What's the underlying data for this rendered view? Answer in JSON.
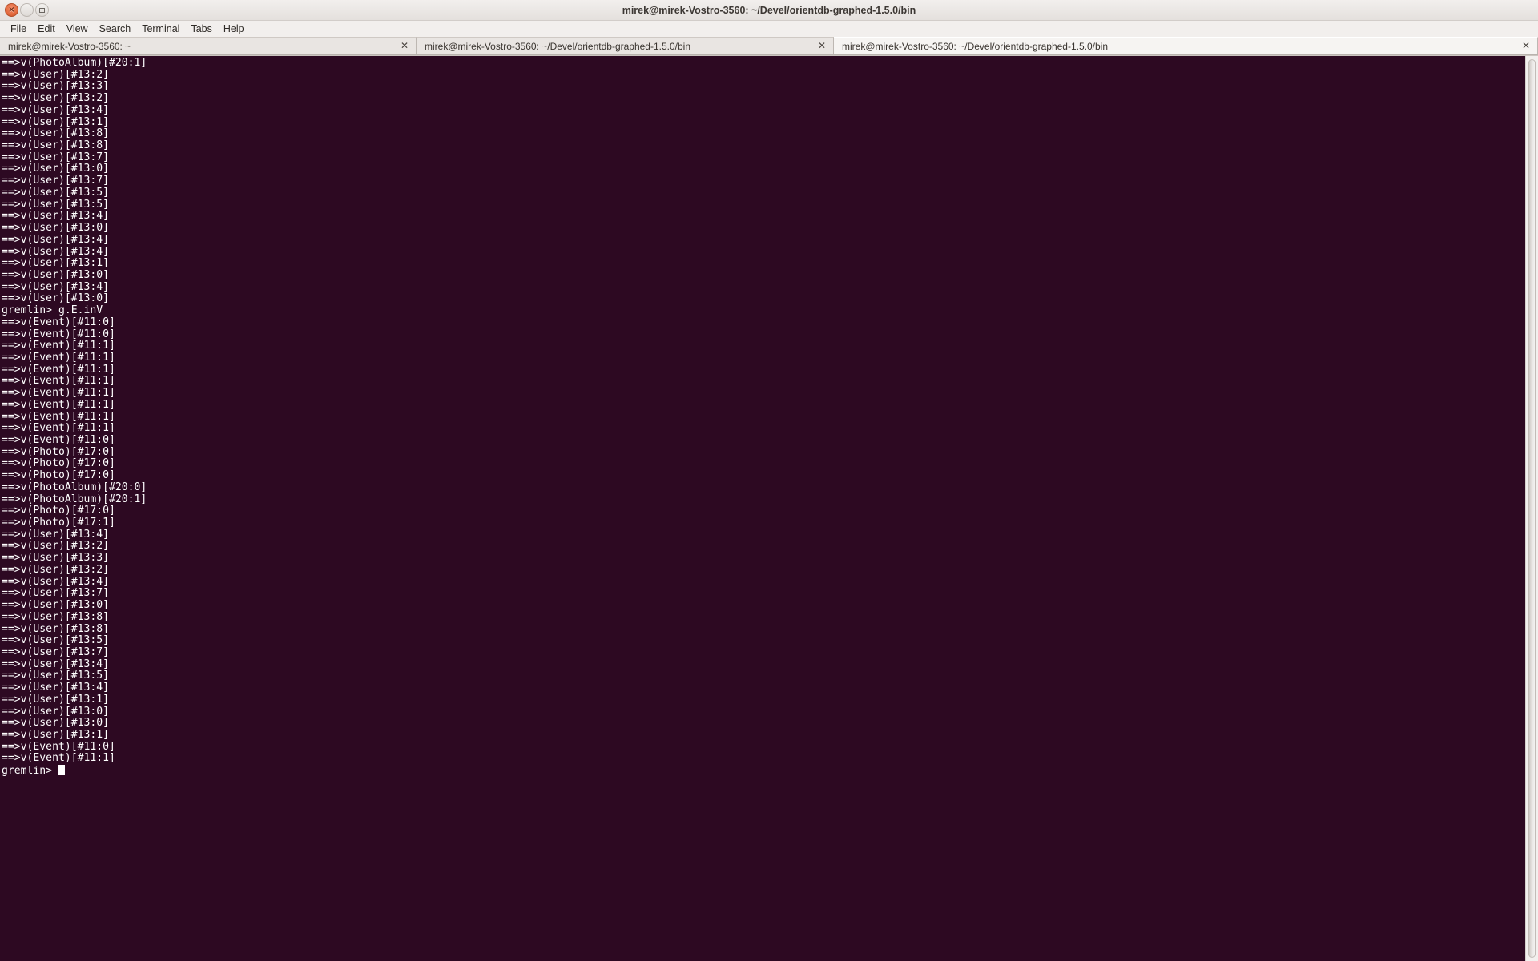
{
  "window": {
    "title": "mirek@mirek-Vostro-3560: ~/Devel/orientdb-graphed-1.5.0/bin",
    "close_label": "×",
    "minimize_label": "",
    "maximize_label": ""
  },
  "menubar": {
    "items": [
      {
        "label": "File"
      },
      {
        "label": "Edit"
      },
      {
        "label": "View"
      },
      {
        "label": "Search"
      },
      {
        "label": "Terminal"
      },
      {
        "label": "Tabs"
      },
      {
        "label": "Help"
      }
    ]
  },
  "tabs": {
    "close_label": "✕",
    "items": [
      {
        "label": "mirek@mirek-Vostro-3560: ~",
        "active": false
      },
      {
        "label": "mirek@mirek-Vostro-3560: ~/Devel/orientdb-graphed-1.5.0/bin",
        "active": false
      },
      {
        "label": "mirek@mirek-Vostro-3560: ~/Devel/orientdb-graphed-1.5.0/bin",
        "active": true
      }
    ]
  },
  "terminal": {
    "background_color": "#2d0922",
    "foreground_color": "#ffffff",
    "prompt": "gremlin>",
    "command": "g.E.inV",
    "cursor_visible": true,
    "lines": [
      "==>v(PhotoAlbum)[#20:1]",
      "==>v(User)[#13:2]",
      "==>v(User)[#13:3]",
      "==>v(User)[#13:2]",
      "==>v(User)[#13:4]",
      "==>v(User)[#13:1]",
      "==>v(User)[#13:8]",
      "==>v(User)[#13:8]",
      "==>v(User)[#13:7]",
      "==>v(User)[#13:0]",
      "==>v(User)[#13:7]",
      "==>v(User)[#13:5]",
      "==>v(User)[#13:5]",
      "==>v(User)[#13:4]",
      "==>v(User)[#13:0]",
      "==>v(User)[#13:4]",
      "==>v(User)[#13:4]",
      "==>v(User)[#13:1]",
      "==>v(User)[#13:0]",
      "==>v(User)[#13:4]",
      "==>v(User)[#13:0]",
      "gremlin> g.E.inV",
      "==>v(Event)[#11:0]",
      "==>v(Event)[#11:0]",
      "==>v(Event)[#11:1]",
      "==>v(Event)[#11:1]",
      "==>v(Event)[#11:1]",
      "==>v(Event)[#11:1]",
      "==>v(Event)[#11:1]",
      "==>v(Event)[#11:1]",
      "==>v(Event)[#11:1]",
      "==>v(Event)[#11:1]",
      "==>v(Event)[#11:0]",
      "==>v(Photo)[#17:0]",
      "==>v(Photo)[#17:0]",
      "==>v(Photo)[#17:0]",
      "==>v(PhotoAlbum)[#20:0]",
      "==>v(PhotoAlbum)[#20:1]",
      "==>v(Photo)[#17:0]",
      "==>v(Photo)[#17:1]",
      "==>v(User)[#13:4]",
      "==>v(User)[#13:2]",
      "==>v(User)[#13:3]",
      "==>v(User)[#13:2]",
      "==>v(User)[#13:4]",
      "==>v(User)[#13:7]",
      "==>v(User)[#13:0]",
      "==>v(User)[#13:8]",
      "==>v(User)[#13:8]",
      "==>v(User)[#13:5]",
      "==>v(User)[#13:7]",
      "==>v(User)[#13:4]",
      "==>v(User)[#13:5]",
      "==>v(User)[#13:4]",
      "==>v(User)[#13:1]",
      "==>v(User)[#13:0]",
      "==>v(User)[#13:0]",
      "==>v(User)[#13:1]",
      "==>v(Event)[#11:0]",
      "==>v(Event)[#11:1]"
    ],
    "prompt_line": "gremlin> "
  }
}
